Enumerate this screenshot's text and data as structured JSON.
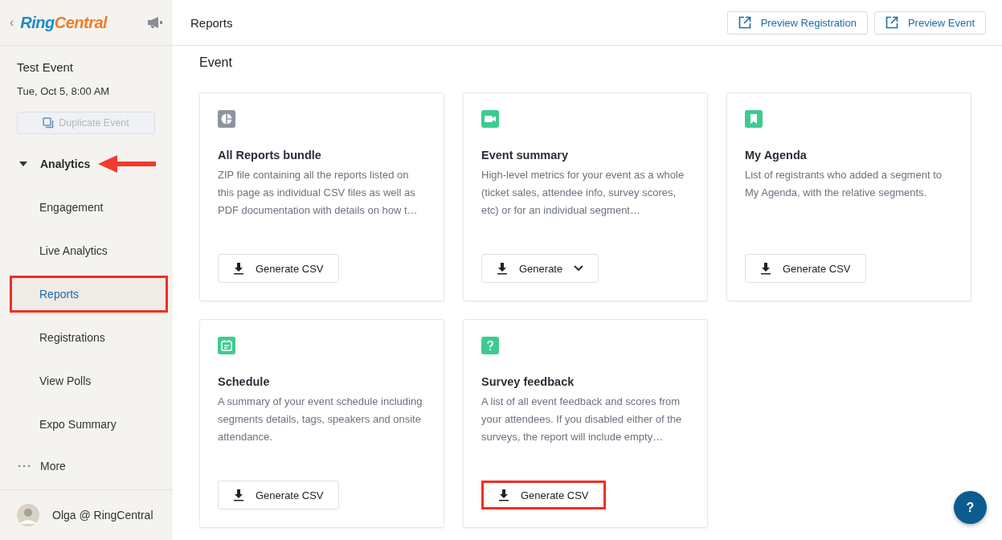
{
  "sidebar": {
    "back_glyph": "‹",
    "logo": {
      "part_1": "Ring",
      "part_2": "Central"
    },
    "event": {
      "title": "Test Event",
      "date": "Tue, Oct 5, 8:00 AM"
    },
    "duplicate_button": {
      "label": "Duplicate Event",
      "disabled": true
    },
    "section": {
      "label": "Analytics",
      "expanded": true,
      "annotation_arrow": true,
      "items": [
        {
          "label": "Engagement",
          "selected": false,
          "highlighted": false
        },
        {
          "label": "Live Analytics",
          "selected": false,
          "highlighted": false
        },
        {
          "label": "Reports",
          "selected": true,
          "highlighted": true
        },
        {
          "label": "Registrations",
          "selected": false,
          "highlighted": false
        },
        {
          "label": "View Polls",
          "selected": false,
          "highlighted": false
        },
        {
          "label": "Expo Summary",
          "selected": false,
          "highlighted": false
        }
      ]
    },
    "more": {
      "label": "More"
    },
    "user": {
      "name": "Olga @ RingCentral"
    }
  },
  "header": {
    "title": "Reports",
    "buttons": [
      {
        "label": "Preview Registration"
      },
      {
        "label": "Preview Event"
      }
    ]
  },
  "section_title": "Event",
  "cards": [
    {
      "kind": "pie",
      "color": "#8e939e",
      "title": "All Reports bundle",
      "description": "ZIP file containing all the reports listed on this page as individual CSV files as well as PDF documentation with details on how t…",
      "button": {
        "label": "Generate CSV",
        "dropdown": false,
        "highlighted": false
      }
    },
    {
      "kind": "video",
      "color": "#3ecb8f",
      "title": "Event summary",
      "description": "High-level metrics for your event as a whole (ticket sales, attendee info, survey scores, etc) or for an individual segment…",
      "button": {
        "label": "Generate",
        "dropdown": true,
        "highlighted": false
      }
    },
    {
      "kind": "bookmark",
      "color": "#3ecb8f",
      "title": "My Agenda",
      "description": "List of registrants who added a segment to My Agenda, with the relative segments.",
      "button": {
        "label": "Generate CSV",
        "dropdown": false,
        "highlighted": false
      }
    },
    {
      "kind": "calendar",
      "color": "#3ecb8f",
      "title": "Schedule",
      "description": "A summary of your event schedule including segments details, tags, speakers and onsite attendance.",
      "button": {
        "label": "Generate CSV",
        "dropdown": false,
        "highlighted": false
      }
    },
    {
      "kind": "question",
      "color": "#3ecb8f",
      "title": "Survey feedback",
      "description": "A list of all event feedback and scores from your attendees. If you disabled either of the surveys, the report will include empty…",
      "button": {
        "label": "Generate CSV",
        "dropdown": false,
        "highlighted": true
      }
    }
  ],
  "help_button": {
    "label": "?"
  }
}
